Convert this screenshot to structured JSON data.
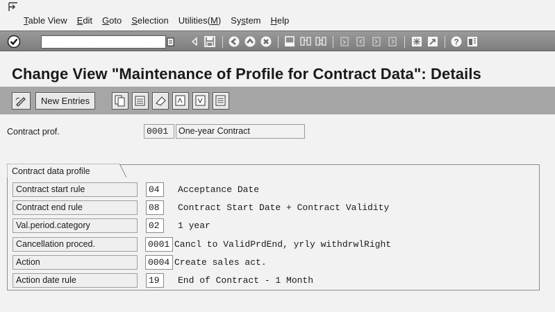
{
  "menu": {
    "items": [
      {
        "label": "Table View",
        "key": "T",
        "rest": "able View"
      },
      {
        "label": "Edit",
        "key": "E",
        "rest": "dit"
      },
      {
        "label": "Goto",
        "key": "G",
        "rest": "oto"
      },
      {
        "label": "Selection",
        "key": "S",
        "rest": "election"
      },
      {
        "label": "Utilities(M)",
        "pre": "Utilities(",
        "key": "M",
        "post": ")"
      },
      {
        "label": "System",
        "pre": "Sy",
        "key": "s",
        "post": "tem"
      },
      {
        "label": "Help",
        "key": "H",
        "rest": "elp"
      }
    ]
  },
  "toolbar": {
    "command_value": "",
    "icons": [
      "enter-icon",
      "back-icon",
      "exit-icon",
      "cancel-icon",
      "print-icon",
      "find-icon",
      "find-next-icon",
      "first-page-icon",
      "previous-page-icon",
      "next-page-icon",
      "last-page-icon",
      "create-session-icon",
      "shortcut-icon",
      "help-icon",
      "layout-icon"
    ]
  },
  "title": "Change View \"Maintenance of Profile for Contract Data\": Details",
  "app_toolbar": {
    "new_entries": "New Entries"
  },
  "contract": {
    "label": "Contract prof.",
    "code": "0001",
    "description": "One-year Contract"
  },
  "group": {
    "title": "Contract data profile",
    "rows": [
      {
        "label": "Contract start rule",
        "value": "04",
        "description": "Acceptance Date"
      },
      {
        "label": "Contract end rule",
        "value": "08",
        "description": "Contract Start Date + Contract Validity"
      },
      {
        "label": "Val.period.category",
        "value": "02",
        "description": "1 year"
      },
      {
        "label": "Cancellation proced.",
        "value": "0001",
        "description": "Cancl to ValidPrdEnd, yrly withdrwlRight"
      },
      {
        "label": "Action",
        "value": "0004",
        "description": "Create sales act."
      },
      {
        "label": "Action date rule",
        "value": "19",
        "description": "End of Contract - 1 Month"
      }
    ]
  }
}
